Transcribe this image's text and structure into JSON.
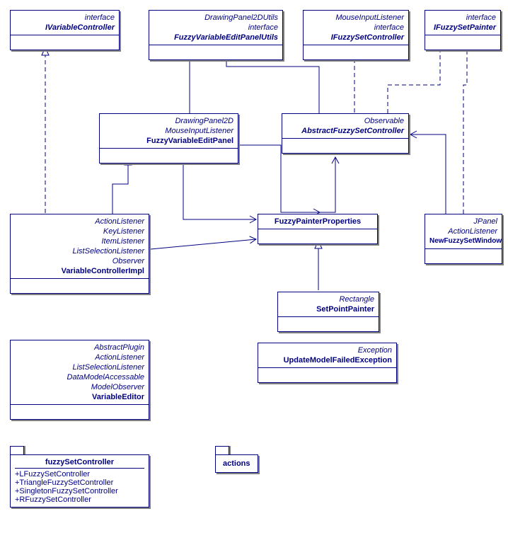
{
  "boxes": {
    "ivariablecontroller": {
      "stereotypes": [
        "interface"
      ],
      "name": "IVariableController",
      "abstract": true
    },
    "fuzzyeditpanelutils": {
      "stereotypes": [
        "DrawingPanel2DUtils",
        "interface"
      ],
      "name": "FuzzyVariableEditPanelUtils",
      "abstract": true
    },
    "ifuzzysetcontroller": {
      "stereotypes": [
        "MouseInputListener",
        "interface"
      ],
      "name": "IFuzzySetController",
      "abstract": true
    },
    "ifuzzysetpainter": {
      "stereotypes": [
        "interface"
      ],
      "name": "IFuzzySetPainter",
      "abstract": true
    },
    "fuzzyvariableeditpanel": {
      "stereotypes": [
        "DrawingPanel2D",
        "MouseInputListener"
      ],
      "name": "FuzzyVariableEditPanel",
      "abstract": false
    },
    "abstractfuzzysetcontroller": {
      "stereotypes": [
        "Observable"
      ],
      "name": "AbstractFuzzySetController",
      "abstract": true
    },
    "variablecontrollerimpl": {
      "stereotypes": [
        "ActionListener",
        "KeyListener",
        "ItemListener",
        "ListSelectionListener",
        "Observer"
      ],
      "name": "VariableControllerImpl",
      "abstract": false
    },
    "fuzzypainterproperties": {
      "stereotypes": [],
      "name": "FuzzyPainterProperties",
      "abstract": false
    },
    "newfuzzysetwindow": {
      "stereotypes": [
        "JPanel",
        "ActionListener"
      ],
      "name": "NewFuzzySetWindow",
      "abstract": false
    },
    "setpointpainter": {
      "stereotypes": [
        "Rectangle"
      ],
      "name": "SetPointPainter",
      "abstract": false
    },
    "variableeditor": {
      "stereotypes": [
        "AbstractPlugin",
        "ActionListener",
        "ListSelectionListener",
        "DataModelAccessable",
        "ModelObserver"
      ],
      "name": "VariableEditor",
      "abstract": false
    },
    "updatemodelfailedexception": {
      "stereotypes": [
        "Exception"
      ],
      "name": "UpdateModelFailedException",
      "abstract": false
    }
  },
  "packages": {
    "fuzzysetcontroller": {
      "name": "fuzzySetController",
      "members": [
        "+LFuzzySetController",
        "+TriangleFuzzySetController",
        "+SingletonFuzzySetController",
        "+RFuzzySetController"
      ]
    },
    "actions": {
      "name": "actions"
    }
  }
}
